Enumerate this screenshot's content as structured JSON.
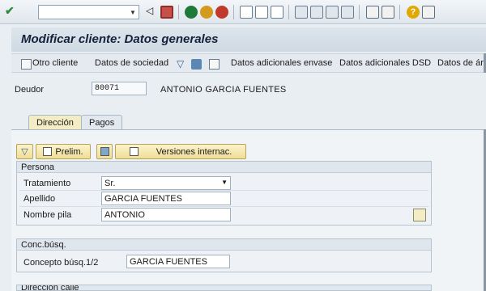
{
  "page": {
    "title": "Modificar cliente: Datos generales"
  },
  "app_toolbar": {
    "otro_cliente": "Otro cliente",
    "datos_sociedad": "Datos de sociedad",
    "datos_envase": "Datos adicionales envase",
    "datos_dsd": "Datos adicionales DSD",
    "datos_area": "Datos de áre"
  },
  "deudor": {
    "label": "Deudor",
    "value": "80071",
    "name": "ANTONIO GARCIA FUENTES"
  },
  "tabs": [
    {
      "label": "Dirección",
      "active": true
    },
    {
      "label": "Pagos",
      "active": false
    }
  ],
  "tab_toolbar": {
    "prelim": "Prelim.",
    "versiones": "Versiones internac."
  },
  "persona": {
    "heading": "Persona",
    "tratamiento_label": "Tratamiento",
    "tratamiento_value": "Sr.",
    "apellido_label": "Apellido",
    "apellido_value": "GARCIA FUENTES",
    "nombre_label": "Nombre pila",
    "nombre_value": "ANTONIO"
  },
  "conc_busq": {
    "heading": "Conc.búsq.",
    "concepto_label": "Concepto búsq.1/2",
    "concepto_value": "GARCIA FUENTES"
  },
  "direccion_calle": {
    "heading": "Dirección calle"
  },
  "colors": {
    "accent": "#f0de95",
    "title": "#12223a",
    "ok": "#2e8b3d",
    "nav": "#1f7a3a",
    "cancel": "#c0392b",
    "help": "#e0a800"
  }
}
